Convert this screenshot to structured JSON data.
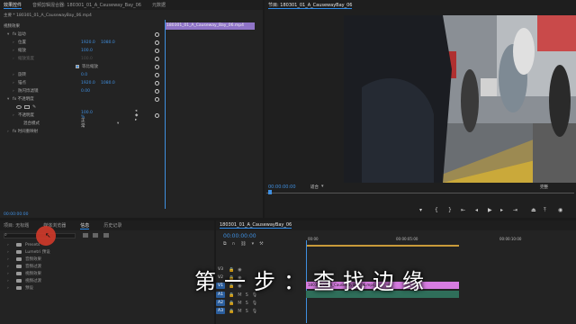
{
  "effect_controls": {
    "tabs": [
      "效果控件",
      "音频剪辑混合器: 180301_01_A_Causeway_Bay_06",
      "元数据"
    ],
    "source": "主要 * 180301_01_A_CausewayBay_06.mp4",
    "clip_header": "180301_01_A_Causeway_Bay_06.mp4",
    "section_video": "视频效果",
    "rows": [
      {
        "label": "fx 运动",
        "value": ""
      },
      {
        "label": "位置",
        "value": "1920.0"
      },
      {
        "label": "缩放",
        "value": "100.0"
      },
      {
        "label": "缩放宽度",
        "value": "100.0"
      },
      {
        "label": "",
        "value": "等比缩放"
      },
      {
        "label": "旋转",
        "value": "0.0"
      },
      {
        "label": "锚点",
        "value": "1920.0"
      },
      {
        "label": "防闪烁滤镜",
        "value": "0.00"
      },
      {
        "label": "fx 不透明度",
        "value": ""
      },
      {
        "label": "",
        "value": ""
      },
      {
        "label": "不透明度",
        "value": "100.0 %"
      },
      {
        "label": "混合模式",
        "value": "正常"
      },
      {
        "label": "fx 时间重映射",
        "value": ""
      }
    ],
    "position_y": "1080.0",
    "anchor_y": "1080.0",
    "timecode": "00:00:00:00"
  },
  "program_monitor": {
    "title": "节目: 180301_01_A_CausewayBay_06",
    "timecode": "00:00:00:00",
    "fit": "适合",
    "fraction": "完整"
  },
  "project": {
    "tabs": [
      "项目: 无标题",
      "媒体浏览器",
      "信息",
      "历史记录"
    ],
    "items": [
      "Presets",
      "Lumetri 预设",
      "音频效果",
      "音频过渡",
      "视频效果",
      "视频过渡",
      "预设"
    ]
  },
  "timeline": {
    "title": "180301_01_A_CausewayBay_06",
    "timecode": "00:00:00:00",
    "ruler": [
      "00:00",
      "00:00:05:00",
      "00:00:10:00"
    ],
    "clip_name": "180301_01_A_CausewayBay_06.mp4",
    "tracks": [
      "V3",
      "V2",
      "V1",
      "A1",
      "A2",
      "A3"
    ]
  },
  "overlay_caption": "第一步：查找边缘",
  "colors": {
    "accent": "#3f8fe0",
    "clip": "#d67ce0"
  }
}
